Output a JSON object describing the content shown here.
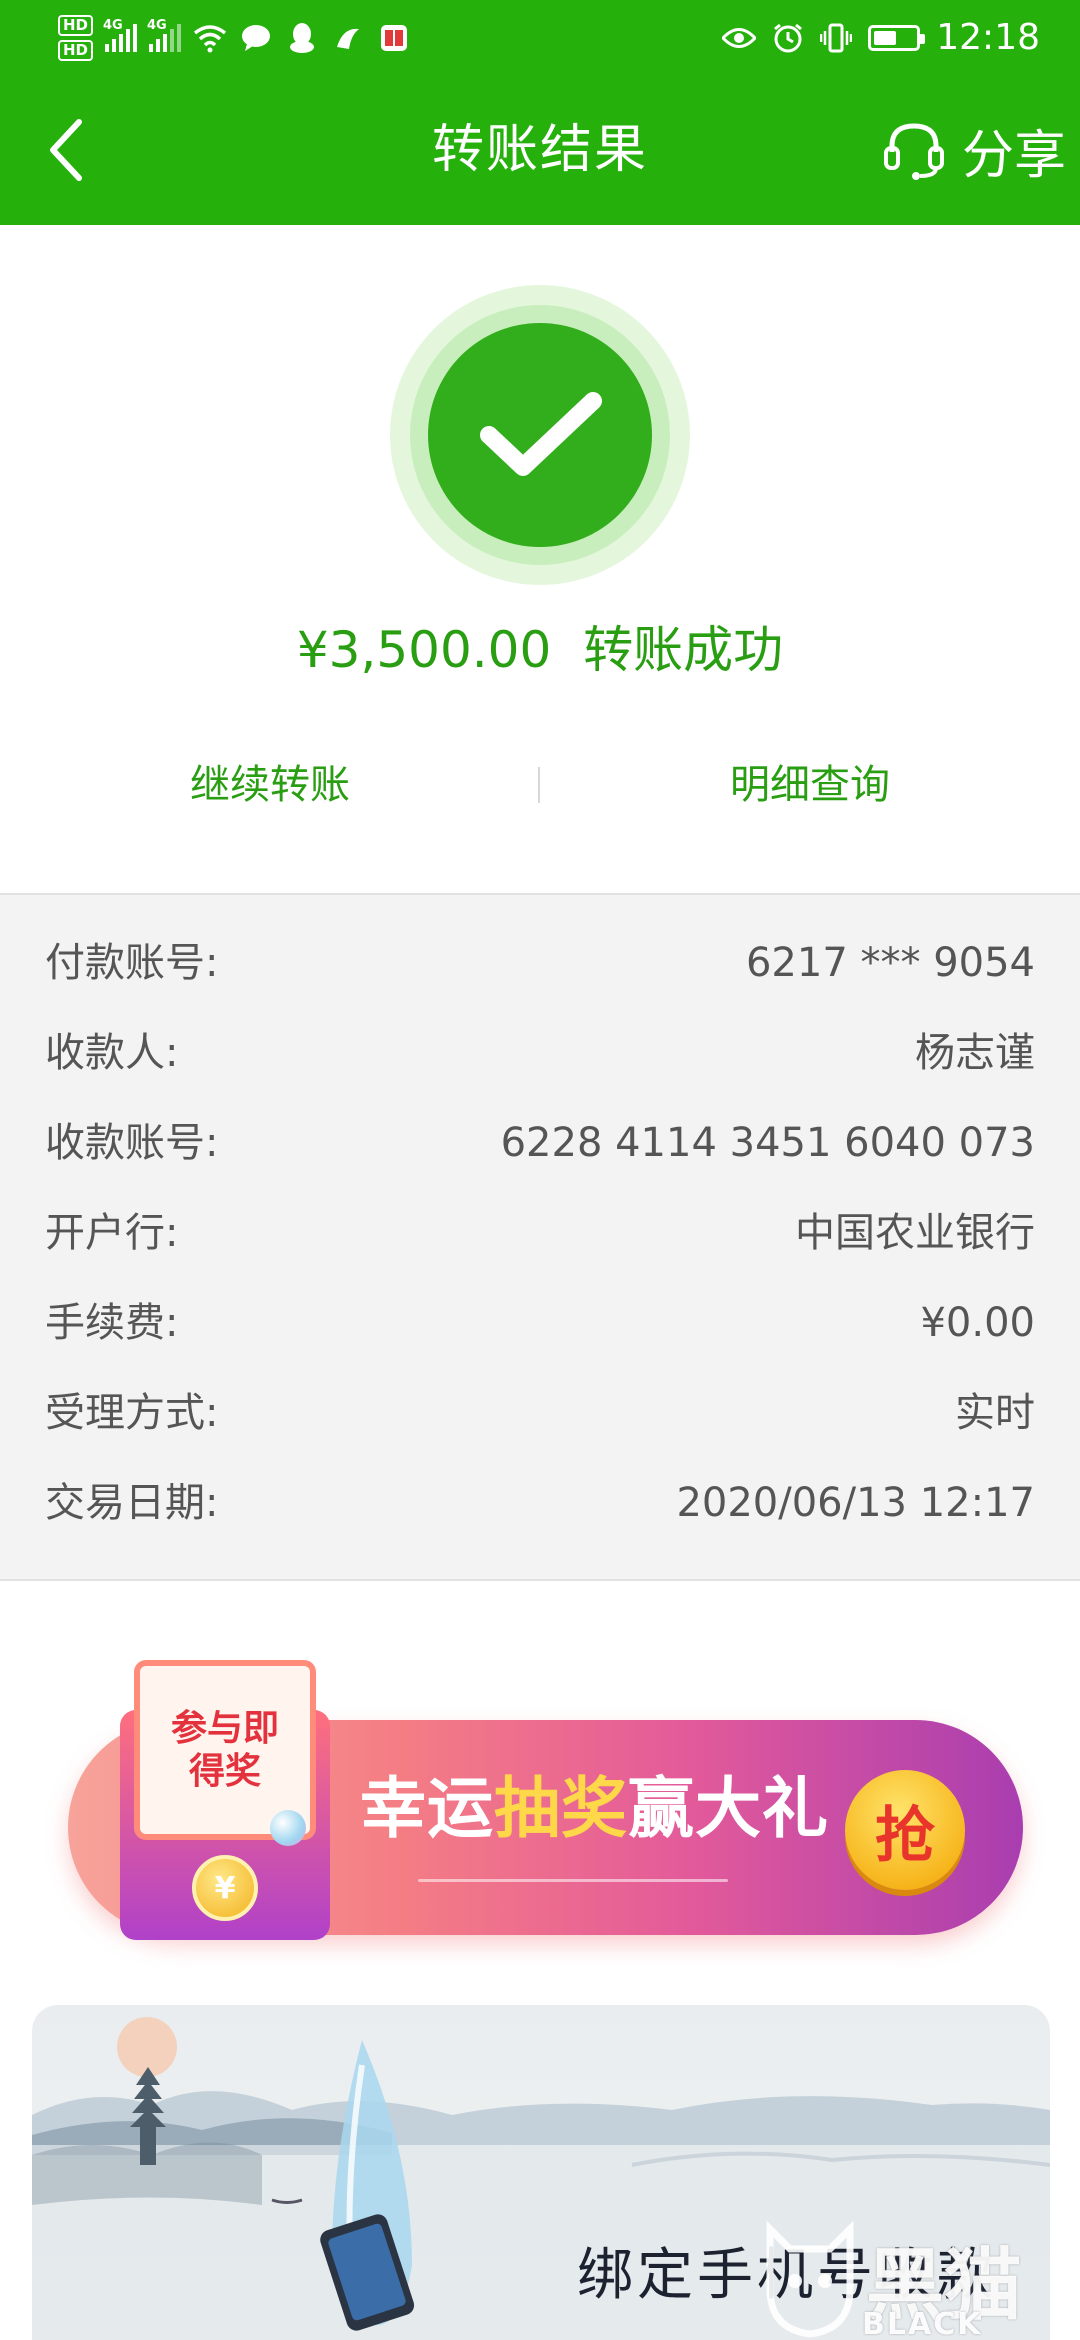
{
  "status_bar": {
    "hd1": "HD",
    "hd2": "HD",
    "net1": "4G",
    "net2": "4G",
    "time": "12:18",
    "battery_level": 0.55,
    "icons": [
      "wifi-icon",
      "chat-icon",
      "qq-icon",
      "app-icon",
      "book-icon",
      "eye-icon",
      "alarm-icon",
      "vibrate-icon",
      "battery-icon"
    ]
  },
  "nav": {
    "title": "转账结果",
    "share_label": "分享"
  },
  "result": {
    "amount": "¥3,500.00",
    "status": "转账成功",
    "actions": [
      "继续转账",
      "明细查询"
    ]
  },
  "details": [
    {
      "label": "付款账号:",
      "value": "6217 *** 9054"
    },
    {
      "label": "收款人:",
      "value": "杨志谨"
    },
    {
      "label": "收款账号:",
      "value": "6228 4114 3451 6040 073"
    },
    {
      "label": "开户行:",
      "value": "中国农业银行"
    },
    {
      "label": "手续费:",
      "value": "¥0.00"
    },
    {
      "label": "受理方式:",
      "value": "实时"
    },
    {
      "label": "交易日期:",
      "value": "2020/06/13  12:17"
    }
  ],
  "banner": {
    "envelope_text_1": "参与即",
    "envelope_text_2": "得奖",
    "coin_symbol": "¥",
    "text_a": "幸运",
    "text_b": "抽奖",
    "text_c": "赢大礼",
    "button": "抢"
  },
  "promo": {
    "text": "绑定手机号收款"
  },
  "watermark": {
    "big": "黑猫",
    "small": "BLACK CAT"
  },
  "colors": {
    "brand_green": "#25b00c",
    "success_green": "#32ae1c",
    "text_green": "#2a9e12"
  }
}
